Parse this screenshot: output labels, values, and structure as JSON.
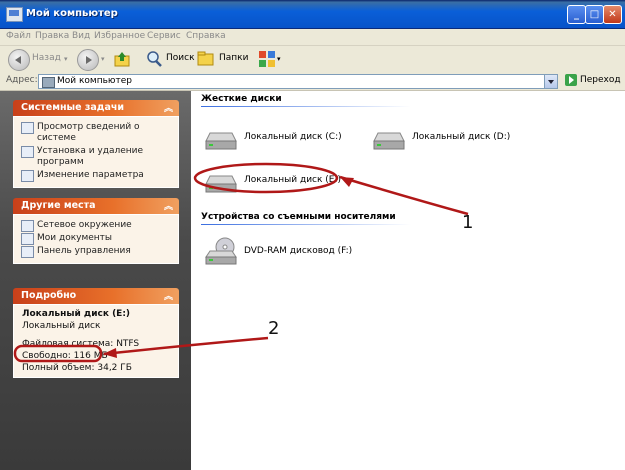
{
  "window": {
    "title": "Мой компьютер",
    "min": "_",
    "max": "□",
    "close": "✕"
  },
  "menu": [
    "Файл",
    "Правка",
    "Вид",
    "Избранное",
    "Сервис",
    "Справка"
  ],
  "toolbar": {
    "back": "Назад",
    "search": "Поиск",
    "folders": "Папки"
  },
  "address": {
    "label": "Адрес:",
    "value": "Мой компьютер",
    "go": "Переход"
  },
  "panels": {
    "system_tasks": {
      "title": "Системные задачи",
      "items": [
        "Просмотр сведений о системе",
        "Установка и удаление программ",
        "Изменение параметра"
      ]
    },
    "other_places": {
      "title": "Другие места",
      "items": [
        "Сетевое окружение",
        "Мои документы",
        "Панель управления"
      ]
    },
    "details": {
      "title": "Подробно",
      "name": "Локальный диск (E:)",
      "type": "Локальный диск",
      "fs": "Файловая система: NTFS",
      "free": "Свободно: 116 МБ",
      "total": "Полный объем: 34,2 ГБ"
    }
  },
  "content": {
    "hard_drives_header": "Жесткие диски",
    "drives": [
      "Локальный диск (C:)",
      "Локальный диск (D:)",
      "Локальный диск (E:)"
    ],
    "removable_header": "Устройства со съемными носителями",
    "removable": [
      "DVD-RAM дисковод (F:)"
    ]
  },
  "annotations": {
    "one": "1",
    "two": "2",
    "color": "#b01818"
  }
}
